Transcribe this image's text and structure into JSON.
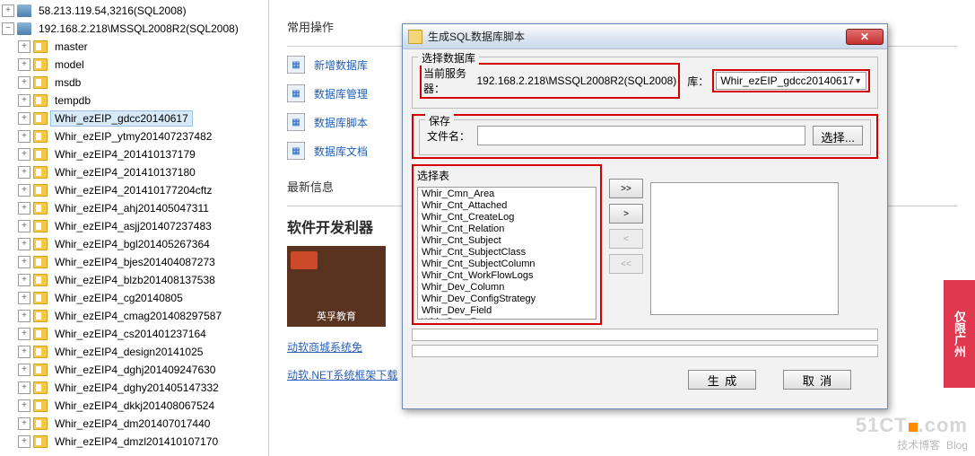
{
  "tree": {
    "servers": [
      {
        "label": "58.213.119.54,3216(SQL2008)",
        "expanded": false
      },
      {
        "label": "192.168.2.218\\MSSQL2008R2(SQL2008)",
        "expanded": true
      }
    ],
    "databases": [
      {
        "label": "master",
        "selected": false
      },
      {
        "label": "model",
        "selected": false
      },
      {
        "label": "msdb",
        "selected": false
      },
      {
        "label": "tempdb",
        "selected": false
      },
      {
        "label": "Whir_ezEIP_gdcc20140617",
        "selected": true
      },
      {
        "label": "Whir_ezEIP_ytmy201407237482",
        "selected": false
      },
      {
        "label": "Whir_ezEIP4_201410137179",
        "selected": false
      },
      {
        "label": "Whir_ezEIP4_201410137180",
        "selected": false
      },
      {
        "label": "Whir_ezEIP4_201410177204cftz",
        "selected": false
      },
      {
        "label": "Whir_ezEIP4_ahj201405047311",
        "selected": false
      },
      {
        "label": "Whir_ezEIP4_asjj201407237483",
        "selected": false
      },
      {
        "label": "Whir_ezEIP4_bgl201405267364",
        "selected": false
      },
      {
        "label": "Whir_ezEIP4_bjes201404087273",
        "selected": false
      },
      {
        "label": "Whir_ezEIP4_blzb201408137538",
        "selected": false
      },
      {
        "label": "Whir_ezEIP4_cg20140805",
        "selected": false
      },
      {
        "label": "Whir_ezEIP4_cmag201408297587",
        "selected": false
      },
      {
        "label": "Whir_ezEIP4_cs201401237164",
        "selected": false
      },
      {
        "label": "Whir_ezEIP4_design20141025",
        "selected": false
      },
      {
        "label": "Whir_ezEIP4_dghj201409247630",
        "selected": false
      },
      {
        "label": "Whir_ezEIP4_dghy201405147332",
        "selected": false
      },
      {
        "label": "Whir_ezEIP4_dkkj201408067524",
        "selected": false
      },
      {
        "label": "Whir_ezEIP4_dm201407017440",
        "selected": false
      },
      {
        "label": "Whir_ezEIP4_dmzl201410107170",
        "selected": false
      }
    ]
  },
  "right": {
    "common_ops_title": "常用操作",
    "ops": [
      {
        "label": "新增数据库"
      },
      {
        "label": "数据库管理"
      },
      {
        "label": "数据库脚本"
      },
      {
        "label": "数据库文档"
      }
    ],
    "latest_title": "最新信息",
    "news_heading": "软件开发利器",
    "banner_text": "英孚教育",
    "link1": "动软商城系统免",
    "link2": "动软.NET系统框架下载",
    "ad_text": "仅限广州"
  },
  "dialog": {
    "title": "生成SQL数据库脚本",
    "select_db_legend": "选择数据库",
    "current_server_label": "当前服务器：",
    "current_server_value": "192.168.2.218\\MSSQL2008R2(SQL2008)",
    "db_label": "库：",
    "db_value": "Whir_ezEIP_gdcc20140617",
    "save_legend": "保存",
    "filename_label": "文件名：",
    "filename_value": "",
    "browse_btn": "选择...",
    "select_table_label": "选择表",
    "tables": [
      "Whir_Cmn_Area",
      "Whir_Cnt_Attached",
      "Whir_Cnt_CreateLog",
      "Whir_Cnt_Relation",
      "Whir_Cnt_Subject",
      "Whir_Cnt_SubjectClass",
      "Whir_Cnt_SubjectColumn",
      "Whir_Cnt_WorkFlowLogs",
      "Whir_Dev_Column",
      "Whir_Dev_ConfigStrategy",
      "Whir_Dev_Field",
      "Whir_Dev_Form"
    ],
    "btn_add_all": ">>",
    "btn_add": ">",
    "btn_remove": "<",
    "btn_remove_all": "<<",
    "btn_generate": "生成",
    "btn_cancel": "取消"
  },
  "watermark": {
    "main": "51CT",
    "suffix": ".com",
    "sub": "技术博客",
    "sub2": "Blog"
  }
}
